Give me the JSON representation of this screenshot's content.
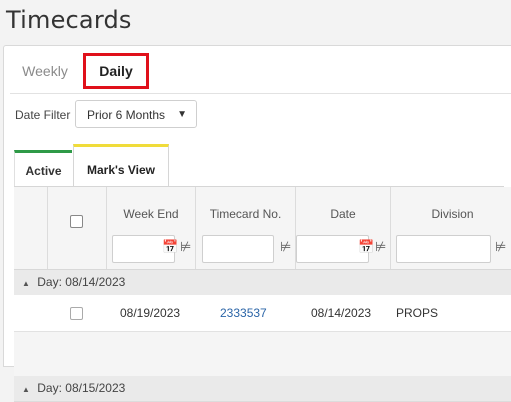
{
  "page": {
    "title": "Timecards"
  },
  "tabs": [
    {
      "label": "Weekly"
    },
    {
      "label": "Daily"
    }
  ],
  "filter": {
    "label": "Date Filter",
    "value": "Prior 6 Months"
  },
  "subtabs": [
    {
      "label": "Active"
    },
    {
      "label": "Mark's View"
    }
  ],
  "grid": {
    "columns": [
      "Week End",
      "Timecard No.",
      "Date",
      "Division"
    ],
    "groups": [
      {
        "label": "Day: 08/14/2023"
      },
      {
        "label": "Day: 08/15/2023"
      }
    ],
    "rows": [
      {
        "week_end": "08/19/2023",
        "timecard_no": "2333537",
        "date": "08/14/2023",
        "division": "PROPS"
      }
    ]
  }
}
